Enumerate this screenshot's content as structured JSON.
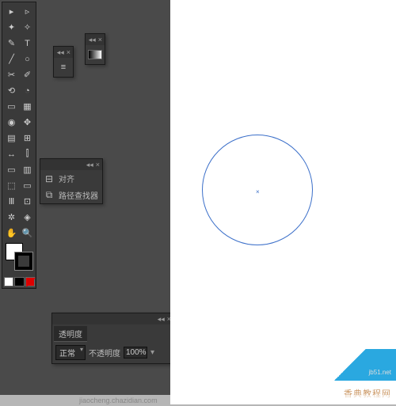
{
  "tools": {
    "row1": [
      "▸",
      "▹"
    ],
    "row2": [
      "✦",
      "✧"
    ],
    "row3": [
      "✎",
      "T"
    ],
    "row4": [
      "╱",
      "○"
    ],
    "row5": [
      "✂",
      "✐"
    ],
    "row6": [
      "⟲",
      "◔"
    ],
    "row7": [
      "▭",
      "▦"
    ],
    "row8": [
      "◉",
      "✥"
    ],
    "row9": [
      "▤",
      "⊞"
    ],
    "row10": [
      "↔",
      "⫿"
    ],
    "row11": [
      "▭",
      "▥"
    ],
    "row12": [
      "⬚",
      "▭"
    ],
    "row13": [
      "Ⅲ",
      "⊡"
    ],
    "row14": [
      "✲",
      "◈"
    ],
    "row15": [
      "✋",
      "🔍"
    ]
  },
  "panel_a": {
    "icon": "≡"
  },
  "panel_b": {
    "icon": "grad"
  },
  "align_panel": {
    "row1_label": "对齐",
    "row2_label": "路径查找器"
  },
  "transparency_panel": {
    "tab": "透明度",
    "mode": "正常",
    "opacity_label": "不透明度",
    "opacity_value": "100%"
  },
  "watermark": {
    "main": "香典教程网",
    "sub": "jb51.net"
  },
  "linkbar": "jiaocheng.chazidian.com"
}
